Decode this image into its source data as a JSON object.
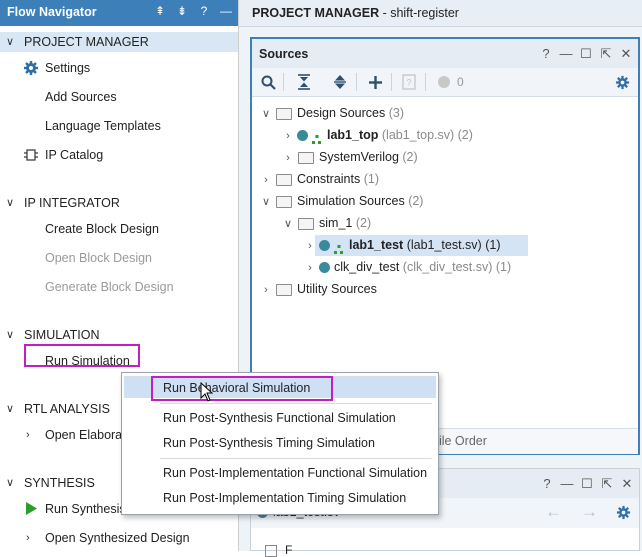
{
  "flow_navigator": {
    "title": "Flow Navigator",
    "header_icons": [
      "collapse-all-icon",
      "expand-all-icon",
      "help-icon",
      "minimize-icon"
    ],
    "project_manager": {
      "label": "PROJECT MANAGER",
      "settings": "Settings",
      "add_sources": "Add Sources",
      "language_templates": "Language Templates",
      "ip_catalog": "IP Catalog"
    },
    "ip_integrator": {
      "label": "IP INTEGRATOR",
      "create": "Create Block Design",
      "open": "Open Block Design",
      "generate": "Generate Block Design"
    },
    "simulation": {
      "label": "SIMULATION",
      "run": "Run Simulation"
    },
    "rtl_analysis": {
      "label": "RTL ANALYSIS",
      "open": "Open Elabora"
    },
    "synthesis": {
      "label": "SYNTHESIS",
      "run": "Run Synthesis",
      "open": "Open Synthesized Design"
    }
  },
  "project_manager_header": {
    "label": "PROJECT MANAGER",
    "project": " - shift-register"
  },
  "sources_panel": {
    "title": "Sources",
    "icons": [
      "help-icon",
      "minimize-icon",
      "maximize-icon",
      "float-icon",
      "close-icon"
    ],
    "toolbar_count": "0",
    "tree": {
      "design_sources": "Design Sources",
      "design_sources_count": "(3)",
      "lab1_top": "lab1_top",
      "lab1_top_file": "(lab1_top.sv)",
      "lab1_top_count": "(2)",
      "systemverilog": "SystemVerilog",
      "systemverilog_count": "(2)",
      "constraints": "Constraints",
      "constraints_count": "(1)",
      "sim_sources": "Simulation Sources",
      "sim_sources_count": "(2)",
      "sim_1": "sim_1",
      "sim_1_count": "(2)",
      "lab1_test": "lab1_test",
      "lab1_test_file": "(lab1_test.sv)",
      "lab1_test_count": "(1)",
      "clk_div_test": "clk_div_test",
      "clk_div_test_file": "(clk_div_test.sv)",
      "clk_div_test_count": "(1)",
      "utility": "Utility Sources"
    },
    "bottom_tab_partial": "pile Order"
  },
  "props_panel": {
    "file": "lab1_test.sv",
    "partial_text": "F"
  },
  "context_menu": {
    "items": [
      "Run Behavioral Simulation",
      "Run Post-Synthesis Functional Simulation",
      "Run Post-Synthesis Timing Simulation",
      "Run Post-Implementation Functional Simulation",
      "Run Post-Implementation Timing Simulation"
    ]
  },
  "colors": {
    "header_blue": "#3d7fb8",
    "selection": "#d5e4f5",
    "highlight_box": "#c020c0",
    "run_green": "#2a9d2a"
  }
}
